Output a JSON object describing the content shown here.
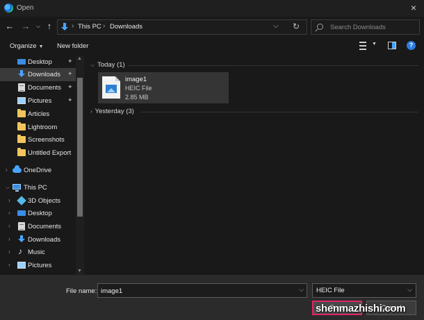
{
  "window": {
    "title": "Open",
    "app_icon": "edge-icon",
    "close_icon": "close-icon"
  },
  "navigation": {
    "back_icon": "arrow-left-icon",
    "forward_icon": "arrow-right-icon",
    "recent_icon": "chevron-down-icon",
    "up_icon": "arrow-up-icon",
    "breadcrumbs": [
      "This PC",
      "Downloads"
    ],
    "search_placeholder": "Search Downloads"
  },
  "toolbar": {
    "organize_label": "Organize",
    "new_folder_label": "New folder"
  },
  "sidebar": {
    "quick_access": [
      {
        "label": "Desktop",
        "icon": "desktop-icon",
        "pinned": true
      },
      {
        "label": "Downloads",
        "icon": "downloads-icon",
        "pinned": true,
        "selected": true
      },
      {
        "label": "Documents",
        "icon": "documents-icon",
        "pinned": true
      },
      {
        "label": "Pictures",
        "icon": "pictures-icon",
        "pinned": true
      },
      {
        "label": "Articles",
        "icon": "folder-icon"
      },
      {
        "label": "Lightroom",
        "icon": "folder-icon"
      },
      {
        "label": "Screenshots",
        "icon": "folder-icon"
      },
      {
        "label": "Untitled Export",
        "icon": "folder-icon"
      }
    ],
    "onedrive": {
      "label": "OneDrive",
      "icon": "onedrive-icon"
    },
    "this_pc": {
      "label": "This PC",
      "icon": "this-pc-icon",
      "children": [
        {
          "label": "3D Objects",
          "icon": "3d-objects-icon"
        },
        {
          "label": "Desktop",
          "icon": "desktop-icon"
        },
        {
          "label": "Documents",
          "icon": "documents-icon"
        },
        {
          "label": "Downloads",
          "icon": "downloads-icon"
        },
        {
          "label": "Music",
          "icon": "music-icon"
        },
        {
          "label": "Pictures",
          "icon": "pictures-icon"
        }
      ]
    }
  },
  "content": {
    "groups": [
      {
        "label": "Today (1)",
        "expanded": true,
        "files": [
          {
            "name": "image1",
            "type": "HEIC File",
            "size": "2.85 MB"
          }
        ]
      },
      {
        "label": "Yesterday (3)",
        "expanded": false
      }
    ]
  },
  "footer": {
    "file_name_label": "File name:",
    "file_name_value": "image1",
    "file_type_value": "HEIC File",
    "open_label": "Open",
    "cancel_label": "Cancel",
    "watermark": "shenmazhishi.com",
    "highlight_color": "#e0246a"
  }
}
